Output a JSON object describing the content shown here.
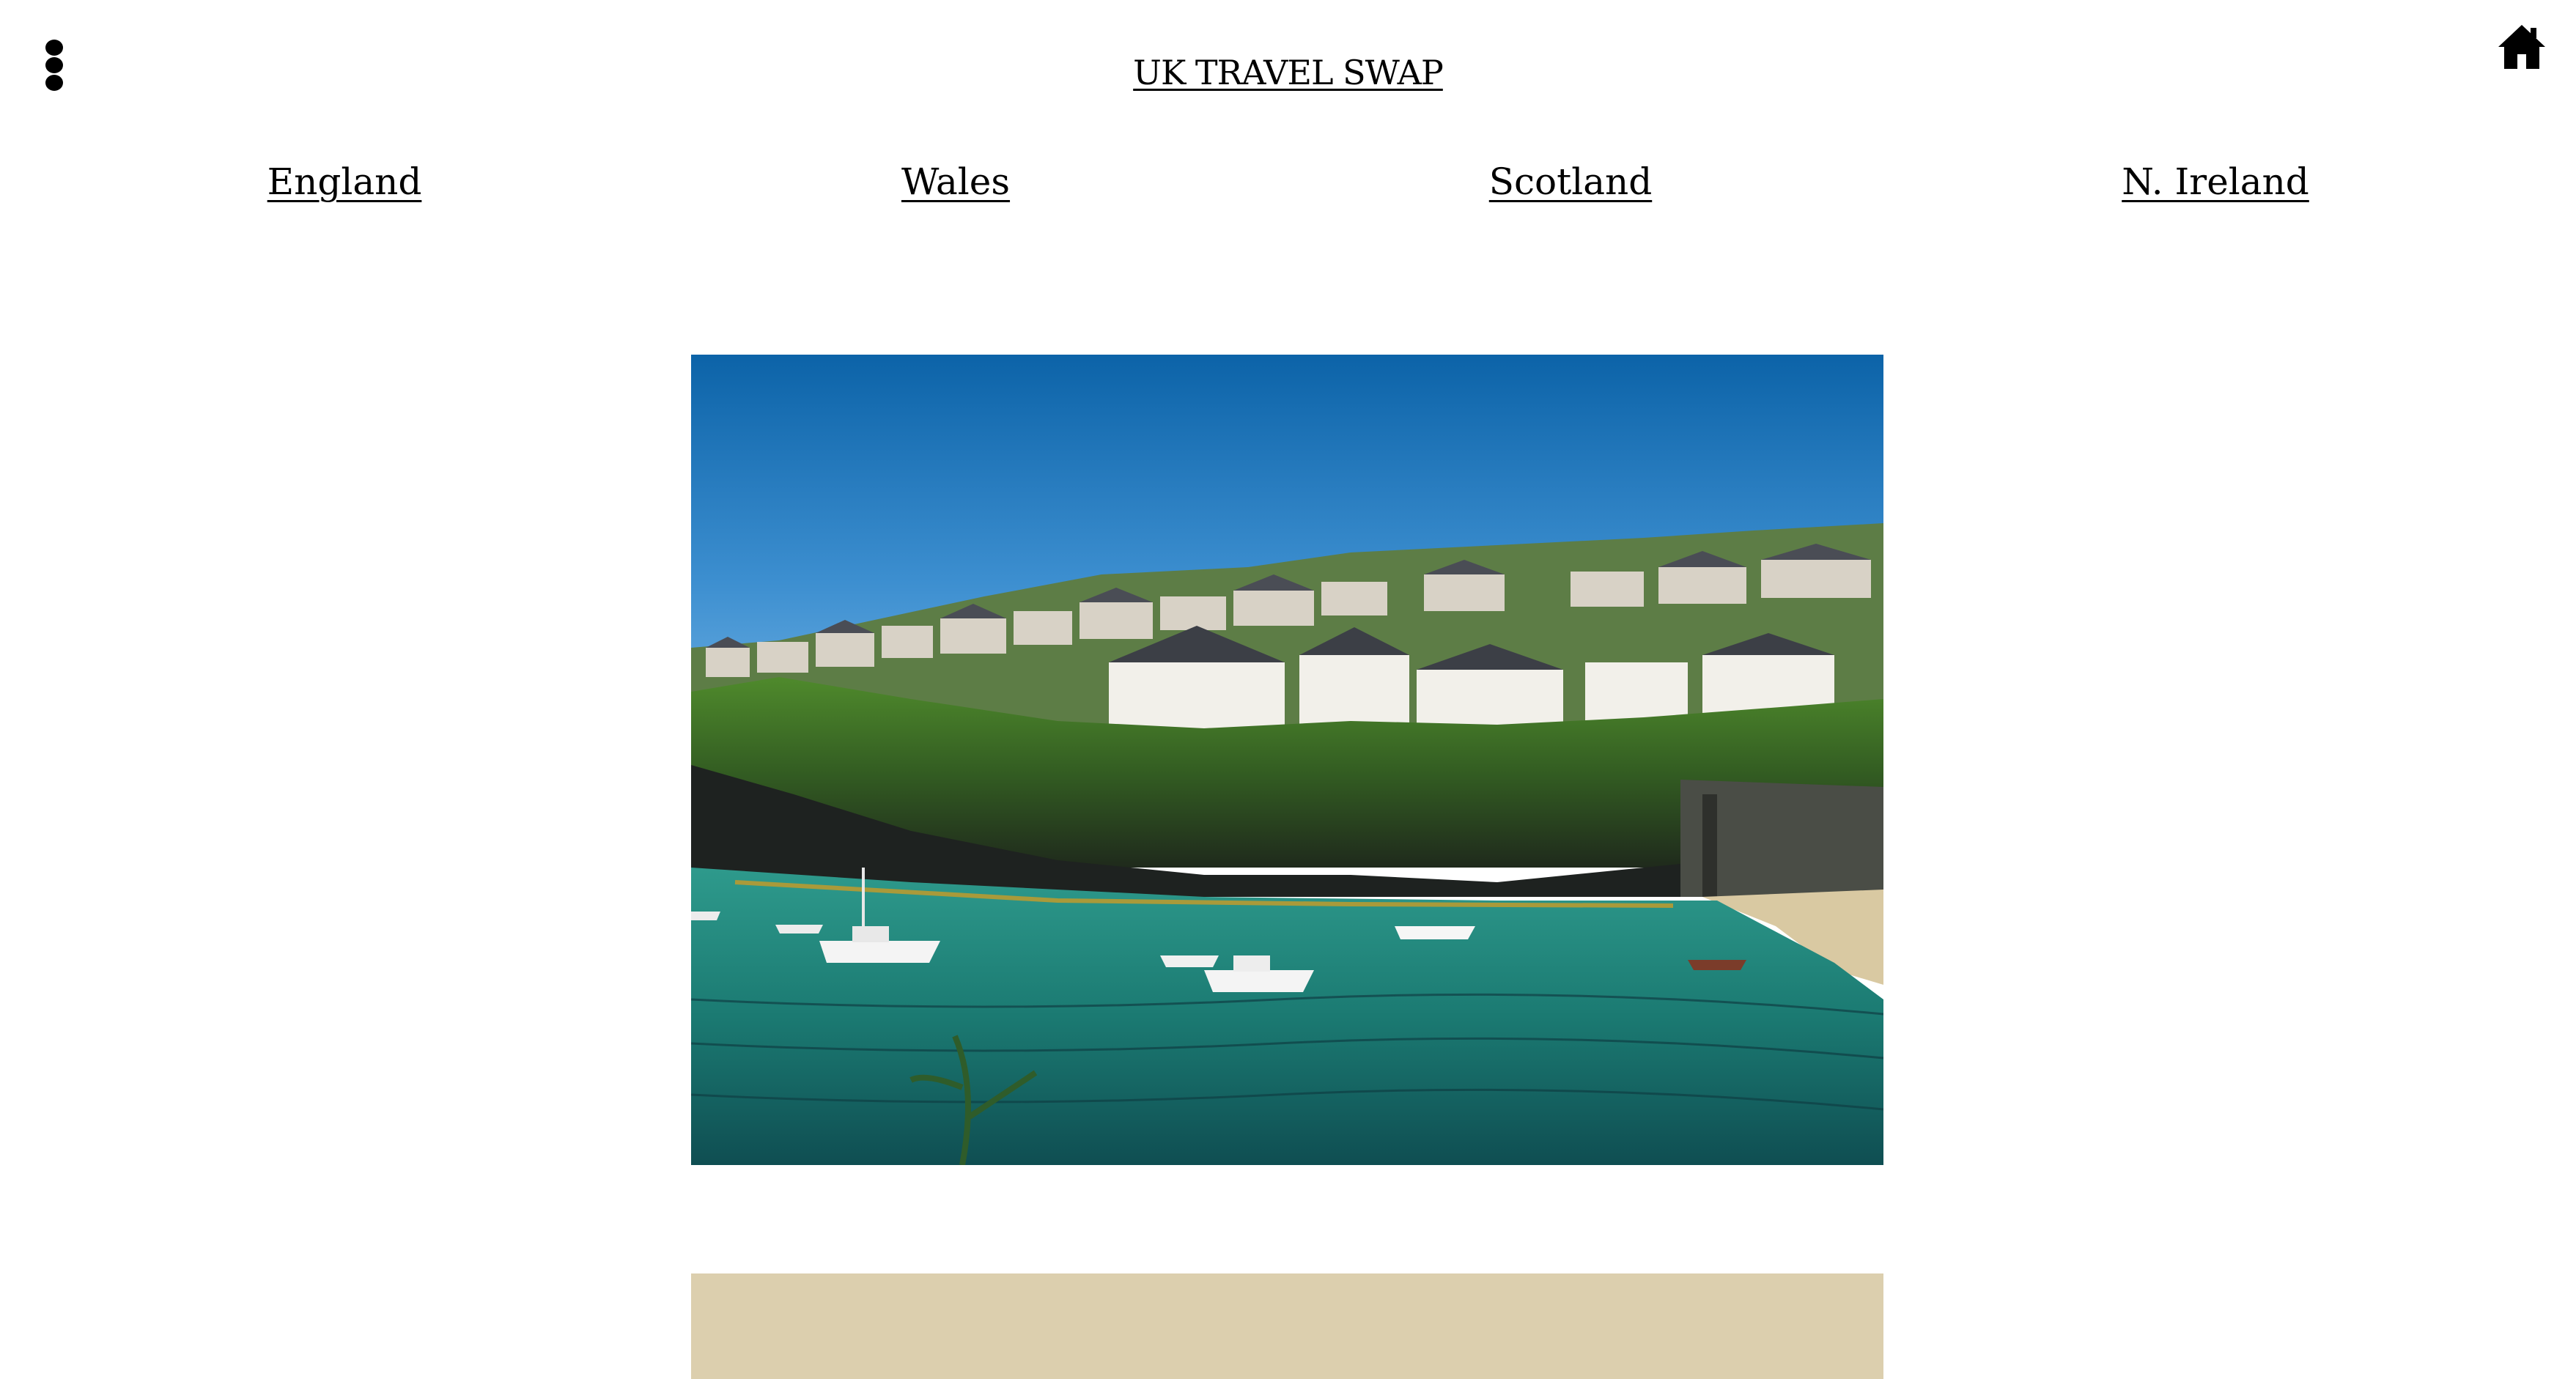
{
  "header": {
    "title": "UK TRAVEL SWAP",
    "menu_icon": "vertical-dots-icon",
    "home_icon": "home-icon"
  },
  "nav": {
    "items": [
      {
        "label": "England"
      },
      {
        "label": "Wales"
      },
      {
        "label": "Scotland"
      },
      {
        "label": "N. Ireland"
      }
    ]
  },
  "colors": {
    "background": "#ffffff",
    "text": "#000000",
    "card": "#dccfae"
  }
}
